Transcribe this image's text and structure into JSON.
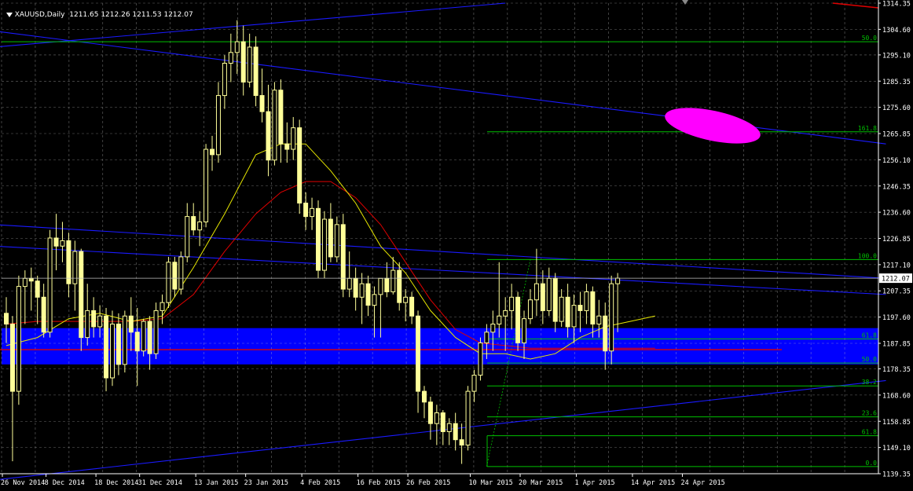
{
  "header": {
    "symbol": "XAUUSD,Daily",
    "ohlc": "1211.65 1212.26 1211.53 1212.07"
  },
  "colors": {
    "background": "#000000",
    "grid": "#c0c0c0",
    "candle": "#ffff99",
    "ma_fast": "#e6e600",
    "ma_slow": "#e00000",
    "trendline": "#1a1aff",
    "zone": "#0000ff",
    "fib": "#00c000",
    "price_line": "#c0c0c0",
    "marker": "#ff00ff"
  },
  "chart_data": {
    "type": "candlestick",
    "symbol": "XAUUSD",
    "timeframe": "Daily",
    "current_price": "1212.07",
    "ylim": [
      1139.35,
      1314.35
    ],
    "y_ticks": [
      "1314.35",
      "1304.60",
      "1295.10",
      "1285.35",
      "1275.60",
      "1265.85",
      "1256.10",
      "1246.35",
      "1236.60",
      "1226.85",
      "1217.10",
      "1212.07",
      "1207.35",
      "1197.60",
      "1187.85",
      "1178.35",
      "1168.60",
      "1158.85",
      "1149.10",
      "1139.35"
    ],
    "x_ticks": [
      {
        "i": 0,
        "label": "26 Nov 2014"
      },
      {
        "i": 7,
        "label": "8 Dec 2014"
      },
      {
        "i": 15,
        "label": "18 Dec 2014"
      },
      {
        "i": 22,
        "label": "31 Dec 2014"
      },
      {
        "i": 31,
        "label": "13 Jan 2015"
      },
      {
        "i": 39,
        "label": "23 Jan 2015"
      },
      {
        "i": 48,
        "label": "4 Feb 2015"
      },
      {
        "i": 57,
        "label": "16 Feb 2015"
      },
      {
        "i": 65,
        "label": "26 Feb 2015"
      },
      {
        "i": 75,
        "label": "10 Mar 2015"
      },
      {
        "i": 83,
        "label": "20 Mar 2015"
      },
      {
        "i": 92,
        "label": "1 Apr 2015"
      },
      {
        "i": 101,
        "label": "14 Apr 2015"
      },
      {
        "i": 109,
        "label": "24 Apr 2015"
      }
    ],
    "candles": [
      [
        1199.0,
        1205.0,
        1188.0,
        1195.0
      ],
      [
        1195.0,
        1198.0,
        1144.0,
        1170.0
      ],
      [
        1170.0,
        1213.0,
        1165.0,
        1209.0
      ],
      [
        1209.0,
        1215.0,
        1195.0,
        1212.0
      ],
      [
        1212.0,
        1216.0,
        1200.0,
        1211.0
      ],
      [
        1211.0,
        1213.0,
        1195.0,
        1205.0
      ],
      [
        1205.0,
        1210.0,
        1190.0,
        1192.0
      ],
      [
        1192.0,
        1230.0,
        1190.0,
        1227.0
      ],
      [
        1227.0,
        1236.0,
        1215.0,
        1224.0
      ],
      [
        1224.0,
        1233.0,
        1218.0,
        1226.0
      ],
      [
        1226.0,
        1229.0,
        1205.0,
        1210.0
      ],
      [
        1210.0,
        1226.0,
        1200.0,
        1222.0
      ],
      [
        1222.0,
        1223.0,
        1185.0,
        1190.0
      ],
      [
        1190.0,
        1210.0,
        1187.0,
        1200.0
      ],
      [
        1200.0,
        1205.0,
        1190.0,
        1194.0
      ],
      [
        1194.0,
        1202.0,
        1190.0,
        1198.0
      ],
      [
        1198.0,
        1201.0,
        1170.0,
        1175.0
      ],
      [
        1175.0,
        1200.0,
        1172.0,
        1195.0
      ],
      [
        1195.0,
        1199.0,
        1176.0,
        1180.0
      ],
      [
        1180.0,
        1200.0,
        1177.0,
        1198.0
      ],
      [
        1198.0,
        1205.0,
        1185.0,
        1192.0
      ],
      [
        1192.0,
        1201.0,
        1172.0,
        1185.0
      ],
      [
        1185.0,
        1197.0,
        1183.0,
        1196.0
      ],
      [
        1196.0,
        1198.0,
        1178.0,
        1184.0
      ],
      [
        1184.0,
        1203.0,
        1182.0,
        1200.0
      ],
      [
        1200.0,
        1206.0,
        1195.0,
        1203.0
      ],
      [
        1203.0,
        1220.0,
        1201.0,
        1218.0
      ],
      [
        1218.0,
        1220.0,
        1205.0,
        1208.0
      ],
      [
        1208.0,
        1222.0,
        1206.0,
        1220.0
      ],
      [
        1220.0,
        1240.0,
        1218.0,
        1235.0
      ],
      [
        1235.0,
        1240.0,
        1228.0,
        1230.0
      ],
      [
        1230.0,
        1237.0,
        1224.0,
        1233.0
      ],
      [
        1233.0,
        1262.0,
        1231.0,
        1260.0
      ],
      [
        1260.0,
        1265.0,
        1252.0,
        1258.0
      ],
      [
        1258.0,
        1285.0,
        1255.0,
        1280.0
      ],
      [
        1280.0,
        1295.0,
        1275.0,
        1292.0
      ],
      [
        1292.0,
        1303.0,
        1285.0,
        1296.0
      ],
      [
        1296.0,
        1308.0,
        1288.0,
        1300.0
      ],
      [
        1300.0,
        1306.0,
        1280.0,
        1285.0
      ],
      [
        1285.0,
        1303.0,
        1283.0,
        1298.0
      ],
      [
        1298.0,
        1302.0,
        1276.0,
        1280.0
      ],
      [
        1280.0,
        1290.0,
        1270.0,
        1274.0
      ],
      [
        1274.0,
        1284.0,
        1250.0,
        1256.0
      ],
      [
        1256.0,
        1285.0,
        1254.0,
        1282.0
      ],
      [
        1282.0,
        1286.0,
        1255.0,
        1262.0
      ],
      [
        1262.0,
        1270.0,
        1255.0,
        1260.0
      ],
      [
        1260.0,
        1272.0,
        1256.0,
        1268.0
      ],
      [
        1268.0,
        1271.0,
        1236.0,
        1240.0
      ],
      [
        1240.0,
        1244.0,
        1230.0,
        1235.0
      ],
      [
        1235.0,
        1242.0,
        1230.0,
        1238.0
      ],
      [
        1238.0,
        1241.0,
        1212.0,
        1215.0
      ],
      [
        1215.0,
        1237.0,
        1212.0,
        1234.0
      ],
      [
        1234.0,
        1240.0,
        1218.0,
        1220.0
      ],
      [
        1220.0,
        1235.0,
        1218.0,
        1232.0
      ],
      [
        1232.0,
        1236.0,
        1205.0,
        1208.0
      ],
      [
        1208.0,
        1222.0,
        1205.0,
        1212.0
      ],
      [
        1212.0,
        1216.0,
        1200.0,
        1205.0
      ],
      [
        1205.0,
        1214.0,
        1195.0,
        1210.0
      ],
      [
        1210.0,
        1213.0,
        1198.0,
        1202.0
      ],
      [
        1202.0,
        1209.0,
        1190.0,
        1206.0
      ],
      [
        1206.0,
        1210.0,
        1190.0,
        1212.0
      ],
      [
        1212.0,
        1218.0,
        1205.0,
        1207.0
      ],
      [
        1207.0,
        1220.0,
        1206.0,
        1215.0
      ],
      [
        1215.0,
        1218.0,
        1200.0,
        1203.0
      ],
      [
        1203.0,
        1208.0,
        1196.0,
        1205.0
      ],
      [
        1205.0,
        1207.0,
        1195.0,
        1198.0
      ],
      [
        1198.0,
        1200.0,
        1162.0,
        1170.0
      ],
      [
        1170.0,
        1172.0,
        1160.0,
        1166.0
      ],
      [
        1166.0,
        1168.0,
        1152.0,
        1158.0
      ],
      [
        1158.0,
        1165.0,
        1150.0,
        1162.0
      ],
      [
        1162.0,
        1163.0,
        1150.0,
        1155.0
      ],
      [
        1155.0,
        1160.0,
        1150.0,
        1158.0
      ],
      [
        1158.0,
        1162.0,
        1148.0,
        1152.0
      ],
      [
        1152.0,
        1158.0,
        1143.0,
        1150.0
      ],
      [
        1150.0,
        1172.0,
        1148.0,
        1170.0
      ],
      [
        1170.0,
        1178.0,
        1166.0,
        1176.0
      ],
      [
        1176.0,
        1190.0,
        1174.0,
        1188.0
      ],
      [
        1188.0,
        1195.0,
        1182.0,
        1192.0
      ],
      [
        1192.0,
        1200.0,
        1185.0,
        1195.0
      ],
      [
        1195.0,
        1218.0,
        1190.0,
        1198.0
      ],
      [
        1198.0,
        1205.0,
        1185.0,
        1200.0
      ],
      [
        1200.0,
        1210.0,
        1193.0,
        1205.0
      ],
      [
        1205.0,
        1207.0,
        1185.0,
        1188.0
      ],
      [
        1188.0,
        1200.0,
        1182.0,
        1197.0
      ],
      [
        1197.0,
        1208.0,
        1195.0,
        1204.0
      ],
      [
        1204.0,
        1223.0,
        1198.0,
        1210.0
      ],
      [
        1210.0,
        1215.0,
        1195.0,
        1200.0
      ],
      [
        1200.0,
        1216.0,
        1198.0,
        1212.0
      ],
      [
        1212.0,
        1214.0,
        1192.0,
        1196.0
      ],
      [
        1196.0,
        1208.0,
        1194.0,
        1205.0
      ],
      [
        1205.0,
        1210.0,
        1190.0,
        1194.0
      ],
      [
        1194.0,
        1206.0,
        1188.0,
        1202.0
      ],
      [
        1202.0,
        1207.0,
        1192.0,
        1200.0
      ],
      [
        1200.0,
        1210.0,
        1195.0,
        1207.0
      ],
      [
        1207.0,
        1209.0,
        1190.0,
        1195.0
      ],
      [
        1195.0,
        1204.0,
        1190.0,
        1198.0
      ],
      [
        1198.0,
        1203.0,
        1178.0,
        1185.0
      ],
      [
        1185.0,
        1213.0,
        1180.0,
        1210.0
      ],
      [
        1210.0,
        1214.0,
        1192.0,
        1212.07
      ]
    ],
    "ma_fast": [
      [
        0,
        1187
      ],
      [
        5,
        1190
      ],
      [
        10,
        1197
      ],
      [
        15,
        1199
      ],
      [
        20,
        1196
      ],
      [
        25,
        1198
      ],
      [
        30,
        1216
      ],
      [
        35,
        1236
      ],
      [
        40,
        1258
      ],
      [
        44,
        1262
      ],
      [
        48,
        1262
      ],
      [
        52,
        1252
      ],
      [
        56,
        1240
      ],
      [
        60,
        1224
      ],
      [
        64,
        1214
      ],
      [
        68,
        1200
      ],
      [
        72,
        1190
      ],
      [
        76,
        1184
      ],
      [
        80,
        1184
      ],
      [
        84,
        1182
      ],
      [
        88,
        1184
      ],
      [
        92,
        1190
      ],
      [
        96,
        1194
      ],
      [
        100,
        1196
      ],
      [
        104,
        1198
      ]
    ],
    "ma_slow": [
      [
        0,
        1195
      ],
      [
        5,
        1196
      ],
      [
        10,
        1196
      ],
      [
        15,
        1196
      ],
      [
        20,
        1196
      ],
      [
        25,
        1197
      ],
      [
        30,
        1206
      ],
      [
        35,
        1222
      ],
      [
        40,
        1236
      ],
      [
        44,
        1244
      ],
      [
        48,
        1248
      ],
      [
        52,
        1248
      ],
      [
        56,
        1242
      ],
      [
        60,
        1232
      ],
      [
        64,
        1218
      ],
      [
        68,
        1204
      ],
      [
        72,
        1193
      ],
      [
        76,
        1188
      ],
      [
        80,
        1187
      ],
      [
        84,
        1186
      ],
      [
        88,
        1186
      ],
      [
        92,
        1186
      ],
      [
        96,
        1186
      ],
      [
        100,
        1186
      ],
      [
        104,
        1186
      ]
    ],
    "zone": [
      1193.5,
      1180.0
    ],
    "horizontal_line": 1185.5,
    "fib_upper": {
      "price_100": 1219.0,
      "levels": [
        {
          "label": "161.8",
          "price": 1266.5
        },
        {
          "label": "100.0",
          "price": 1219.0
        },
        {
          "label": "61.8",
          "price": 1189.5
        },
        {
          "label": "50.0",
          "price": 1180.5
        }
      ]
    },
    "fib_lower": {
      "levels": [
        {
          "label": "50.0",
          "price": 1300.0
        },
        {
          "label": "38.2",
          "price": 1172.0
        },
        {
          "label": "23.6",
          "price": 1160.5
        },
        {
          "label": "61.8",
          "price": 1153.5
        },
        {
          "label": "0.0",
          "price": 1142.0
        }
      ]
    }
  }
}
